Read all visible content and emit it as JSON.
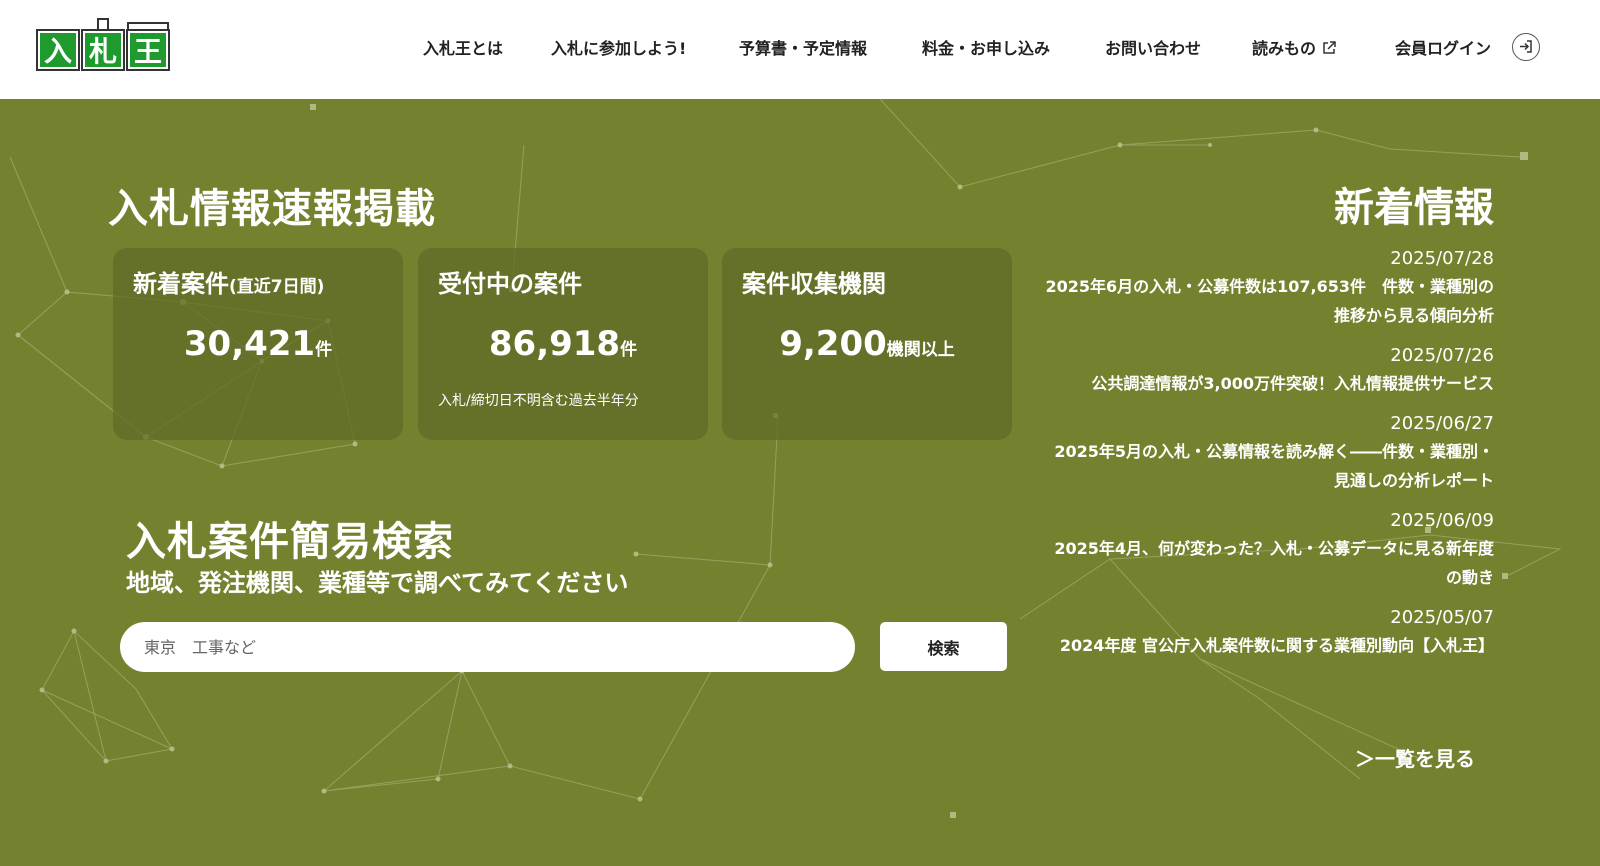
{
  "brand": {
    "logo_text": "入札王",
    "logo_color": "#1e9a2e"
  },
  "nav": {
    "items": [
      {
        "label": "入札王とは"
      },
      {
        "label": "入札に参加しよう!"
      },
      {
        "label": "予算書・予定情報"
      },
      {
        "label": "料金・お申し込み"
      },
      {
        "label": "お問い合わせ"
      },
      {
        "label": "読みもの",
        "icon": "external-link-icon"
      },
      {
        "label": "会員ログイン",
        "icon": "login-icon"
      }
    ]
  },
  "colors": {
    "hero_background": "#74822f",
    "card_background": "#65712a",
    "text": "#ffffff"
  },
  "stats": {
    "title": "入札情報速報掲載",
    "cards": [
      {
        "title": "新着案件",
        "subtitle": "(直近7日間)",
        "value": "30,421",
        "unit": "件",
        "note": ""
      },
      {
        "title": "受付中の案件",
        "subtitle": "",
        "value": "86,918",
        "unit": "件",
        "note": "入札/締切日不明含む過去半年分"
      },
      {
        "title": "案件収集機関",
        "subtitle": "",
        "value": "9,200",
        "unit": "機関以上",
        "note": ""
      }
    ]
  },
  "search": {
    "title": "入札案件簡易検索",
    "subtitle": "地域、発注機関、業種等で調べてみてください",
    "placeholder": "東京　工事など",
    "value": "",
    "button_label": "検索"
  },
  "news": {
    "title": "新着情報",
    "items": [
      {
        "date": "2025/07/28",
        "title": "2025年6月の入札・公募件数は107,653件　件数・業種別の推移から見る傾向分析"
      },
      {
        "date": "2025/07/26",
        "title": "公共調達情報が3,000万件突破！入札情報提供サービス"
      },
      {
        "date": "2025/06/27",
        "title": "2025年5月の入札・公募情報を読み解く――件数・業種別・見通しの分析レポート"
      },
      {
        "date": "2025/06/09",
        "title": "2025年4月、何が変わった？入札・公募データに見る新年度の動き"
      },
      {
        "date": "2025/05/07",
        "title": "2024年度 官公庁入札案件数に関する業種別動向【入札王】"
      }
    ],
    "more_label": "＞一覧を見る"
  }
}
